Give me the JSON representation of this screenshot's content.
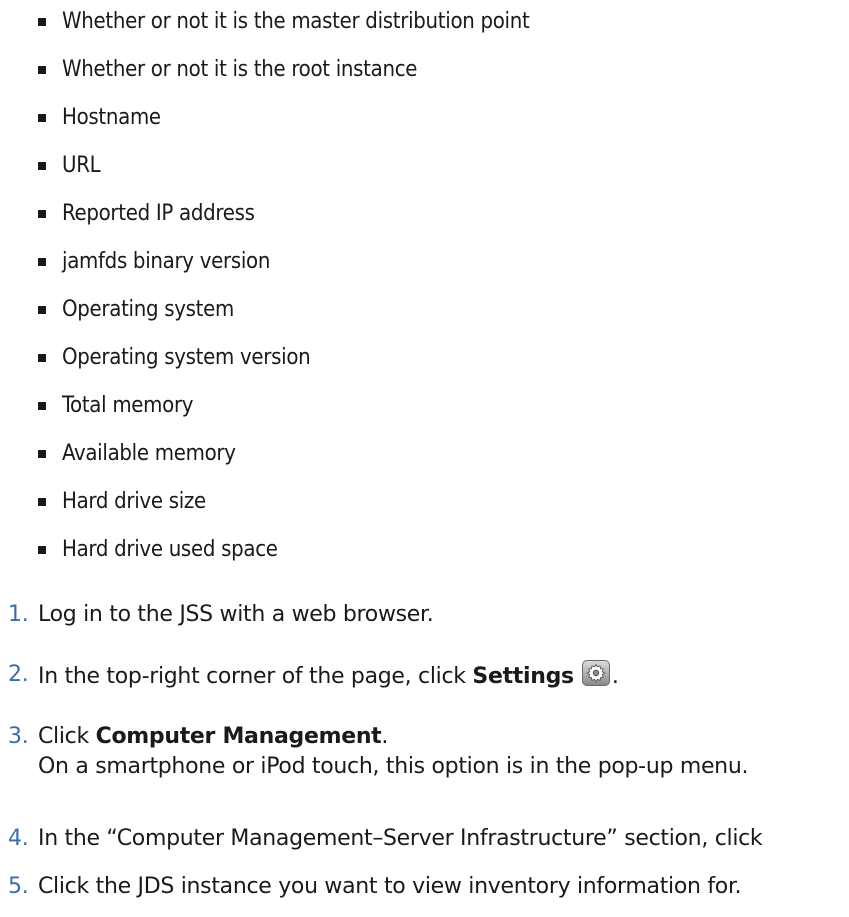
{
  "bullets": [
    "Whether or not it is the master distribution point",
    "Whether or not it is the root instance",
    "Hostname",
    "URL",
    "Reported IP address",
    "jamfds binary version",
    "Operating system",
    "Operating system version",
    "Total memory",
    "Available memory",
    "Hard drive size",
    "Hard drive used space"
  ],
  "steps": {
    "s1": {
      "num": "1.",
      "text": "Log in to the JSS with a web browser."
    },
    "s2": {
      "num": "2.",
      "pre": "In the top-right corner of the page, click ",
      "bold": "Settings",
      "post": ".",
      "icon": "gear-icon"
    },
    "s3": {
      "num": "3.",
      "pre": "Click ",
      "bold": "Computer Management",
      "post": ".",
      "note": "On a smartphone or iPod touch, this option is in the pop-up menu."
    },
    "s4": {
      "num": "4.",
      "text": "In the “Computer Management–Server Infrastructure” section, click"
    },
    "s5": {
      "num": "5.",
      "text": "Click the JDS instance you want to view inventory information for."
    }
  },
  "colors": {
    "text": "#1a1a1a",
    "step_number": "#3a6ea5"
  }
}
